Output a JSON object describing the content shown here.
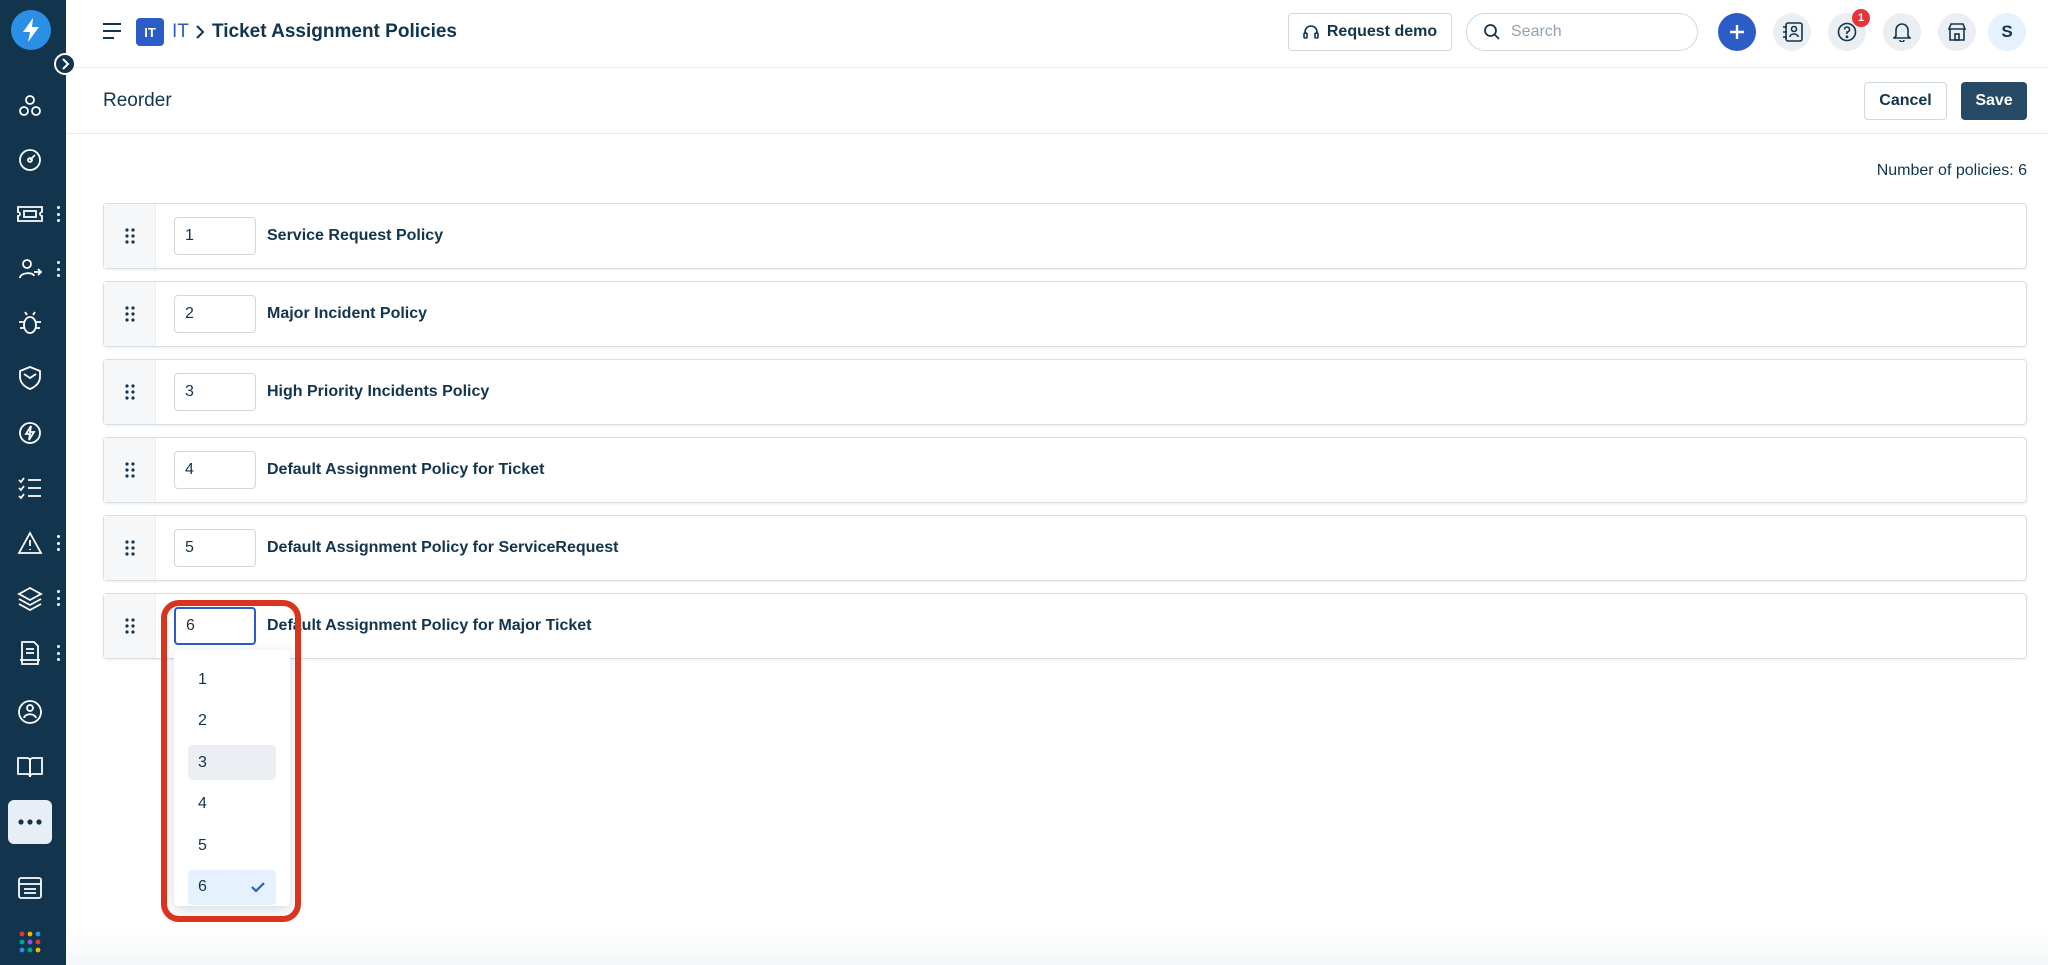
{
  "app": {
    "rail": {
      "items": [
        {
          "icon": "ai-network-icon",
          "has_menu": false
        },
        {
          "icon": "dashboard-gauge-icon",
          "has_menu": false
        },
        {
          "icon": "tickets-icon",
          "has_menu": true
        },
        {
          "icon": "user-switch-icon",
          "has_menu": true
        },
        {
          "icon": "problems-bug-icon",
          "has_menu": false
        },
        {
          "icon": "shield-icon",
          "has_menu": false
        },
        {
          "icon": "changes-bolt-icon",
          "has_menu": false
        },
        {
          "icon": "task-list-icon",
          "has_menu": false
        },
        {
          "icon": "alert-icon",
          "has_menu": true
        },
        {
          "icon": "assets-layers-icon",
          "has_menu": true
        },
        {
          "icon": "service-desk-icon",
          "has_menu": true
        },
        {
          "icon": "org-chart-icon",
          "has_menu": false
        },
        {
          "icon": "knowledge-book-icon",
          "has_menu": false
        },
        {
          "icon": "more-icon",
          "has_menu": false
        },
        {
          "icon": "dashboard-panel-icon",
          "has_menu": false
        },
        {
          "icon": "apps-grid-icon",
          "has_menu": false
        }
      ]
    }
  },
  "header": {
    "workspace_badge": "IT",
    "workspace_crumb": "IT",
    "title": "Ticket Assignment Policies",
    "request_demo_label": "Request demo",
    "search_placeholder": "Search",
    "help_badge_count": "1",
    "avatar_initial": "S"
  },
  "subheader": {
    "title": "Reorder",
    "cancel_label": "Cancel",
    "save_label": "Save"
  },
  "main": {
    "count_label": "Number of policies: 6",
    "policies": [
      {
        "order": "1",
        "name": "Service Request Policy"
      },
      {
        "order": "2",
        "name": "Major Incident Policy"
      },
      {
        "order": "3",
        "name": "High Priority Incidents Policy"
      },
      {
        "order": "4",
        "name": "Default Assignment Policy for Ticket"
      },
      {
        "order": "5",
        "name": "Default Assignment Policy for ServiceRequest"
      },
      {
        "order": "6",
        "name": "Default Assignment Policy for Major Ticket"
      }
    ],
    "dropdown": {
      "options": [
        "1",
        "2",
        "3",
        "4",
        "5",
        "6"
      ],
      "hovered": "3",
      "selected": "6"
    }
  },
  "colors": {
    "rail_bg": "#12344d",
    "accent_blue": "#2c5cc5",
    "save_bg": "#264966",
    "highlight_red": "#d8341e",
    "notif_red": "#e43538"
  }
}
